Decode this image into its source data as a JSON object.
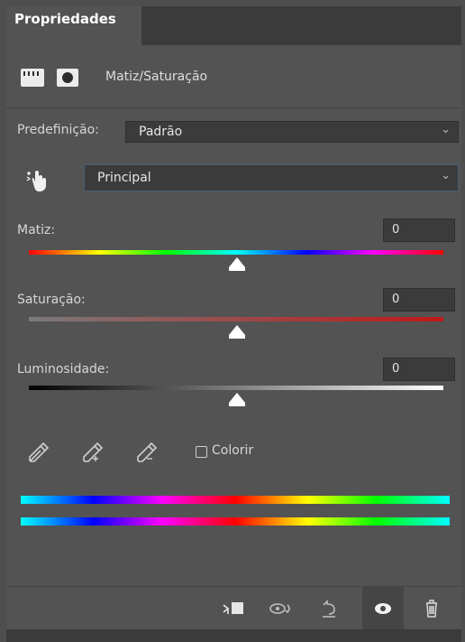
{
  "panel": {
    "tab_label": "Propriedades",
    "header_title": "Matiz/Saturação"
  },
  "preset": {
    "label": "Predefinição:",
    "value": "Padrão"
  },
  "channel": {
    "value": "Principal"
  },
  "sliders": [
    {
      "label": "Matiz:",
      "value": "0",
      "position": 0.5
    },
    {
      "label": "Saturação:",
      "value": "0",
      "position": 0.5
    },
    {
      "label": "Luminosidade:",
      "value": "0",
      "position": 0.5
    }
  ],
  "colorize": {
    "label": "Colorir",
    "checked": false
  },
  "icons": {
    "adjustment": "adjustment-layer-icon",
    "mask": "mask-icon",
    "targeted_adjustment": "hand-targeted-adjustment-icon",
    "eyedropper": "eyedropper-icon",
    "eyedropper_plus": "eyedropper-add-icon",
    "eyedropper_minus": "eyedropper-subtract-icon",
    "clip": "clip-to-layer-icon",
    "view_previous": "view-previous-state-icon",
    "reset": "reset-icon",
    "visibility": "eye-icon",
    "delete": "trash-icon"
  },
  "colors": {
    "panel_bg": "#535353",
    "tab_bar_bg": "#3b3b3b",
    "field_bg": "#3b3b3b",
    "focus_border": "#46607a",
    "active_footer_button": "#454545"
  }
}
